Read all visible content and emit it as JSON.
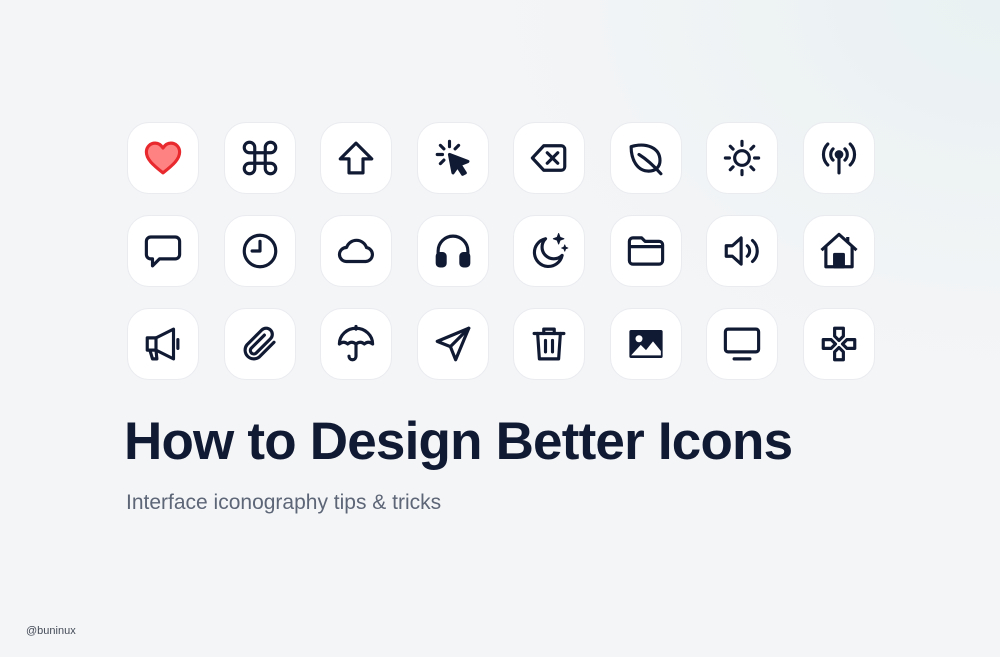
{
  "title": "How to Design Better Icons",
  "subtitle": "Interface iconography tips & tricks",
  "credit": "@buninux",
  "colors": {
    "icon_stroke": "#111a33",
    "heart_fill": "#ff7f80",
    "heart_stroke": "#e8292d",
    "title": "#111a33",
    "subtitle": "#5d6677"
  },
  "icons": [
    [
      "heart-icon",
      "command-icon",
      "arrow-up-icon",
      "cursor-click-icon",
      "backspace-icon",
      "leaf-icon",
      "sun-icon",
      "antenna-icon"
    ],
    [
      "chat-bubble-icon",
      "clock-icon",
      "cloud-icon",
      "headphones-icon",
      "moon-stars-icon",
      "folder-icon",
      "speaker-volume-icon",
      "home-icon"
    ],
    [
      "megaphone-icon",
      "paperclip-icon",
      "umbrella-icon",
      "send-icon",
      "trash-icon",
      "image-icon",
      "monitor-icon",
      "gamepad-icon"
    ]
  ]
}
